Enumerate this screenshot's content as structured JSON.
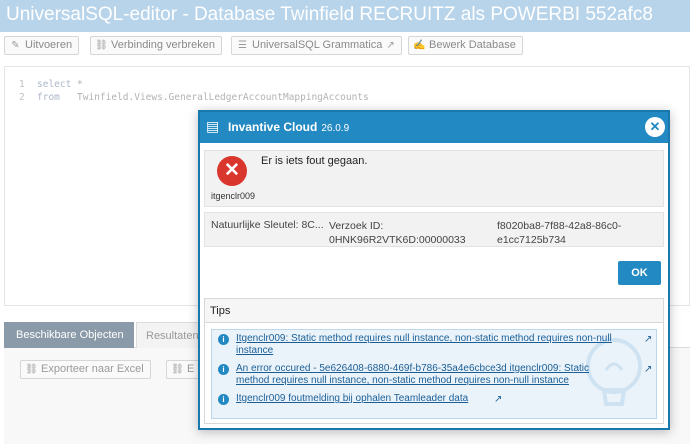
{
  "app": {
    "title": "UniversalSQL-editor - Database Twinfield RECRUITZ als POWERBI 552afc8"
  },
  "toolbar": {
    "run": "Uitvoeren",
    "disconnect": "Verbinding verbreken",
    "grammar": "UniversalSQL Grammatica",
    "edit_db": "Bewerk Database"
  },
  "editor": {
    "lines": [
      {
        "num": "1",
        "kw": "select",
        "text": " *"
      },
      {
        "num": "2",
        "kw": "from",
        "text": "   Twinfield.Views.GeneralLedgerAccountMappingAccounts"
      }
    ]
  },
  "tabs": {
    "objects": "Beschikbare Objecten",
    "results": "Resultaten"
  },
  "lower": {
    "export_excel": "Exporteer naar Excel",
    "export_other": "E"
  },
  "dialog": {
    "title": "Invantive Cloud",
    "version": "26.0.9",
    "error_code": "itgenclr009",
    "error_message": "Er is iets fout gegaan.",
    "natural_key": "Natuurlijke Sleutel: 8C...",
    "request_id_label": "Verzoek ID:",
    "request_id_value": "0HNK96R2VTK6D:00000033",
    "guid": "f8020ba8-7f88-42a8-86c0-e1cc7125b734",
    "ok": "OK",
    "tips_header": "Tips",
    "tips": [
      "Itgenclr009: Static method requires null instance, non-static method requires non-null instance",
      "An error occured - 5e626408-6880-469f-b786-35a4e6cbce3d itgenclr009: Static method requires null instance, non-static method requires non-null instance",
      "Itgenclr009 foutmelding bij ophalen Teamleader data"
    ]
  },
  "icons": {
    "close": "close-icon",
    "error": "error-icon",
    "info": "info-icon",
    "external": "external-link-icon"
  },
  "colors": {
    "accent": "#2389c3",
    "error": "#d9362e",
    "titlebar": "#b8d4ea"
  }
}
